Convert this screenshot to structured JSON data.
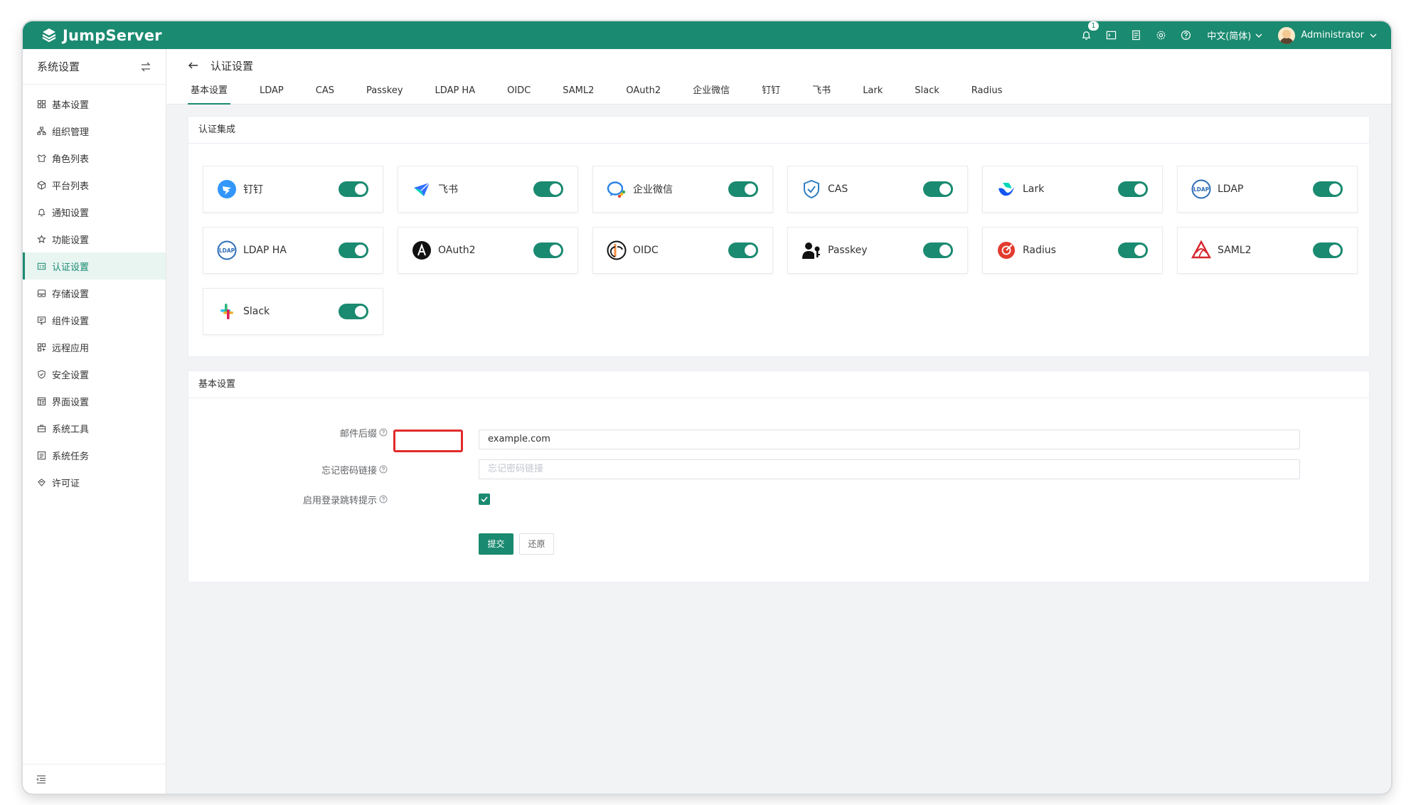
{
  "app": {
    "name": "JumpServer"
  },
  "topbar": {
    "notification_count": "1",
    "language": "中文(简体)",
    "user": "Administrator"
  },
  "sidebar": {
    "title": "系统设置",
    "items": [
      {
        "label": "基本设置",
        "icon": "grid-icon"
      },
      {
        "label": "组织管理",
        "icon": "org-icon"
      },
      {
        "label": "角色列表",
        "icon": "role-icon"
      },
      {
        "label": "平台列表",
        "icon": "cube-icon"
      },
      {
        "label": "通知设置",
        "icon": "bell-icon"
      },
      {
        "label": "功能设置",
        "icon": "star-icon"
      },
      {
        "label": "认证设置",
        "icon": "id-card-icon",
        "active": true
      },
      {
        "label": "存储设置",
        "icon": "storage-icon"
      },
      {
        "label": "组件设置",
        "icon": "monitor-icon"
      },
      {
        "label": "远程应用",
        "icon": "apps-icon"
      },
      {
        "label": "安全设置",
        "icon": "shield-icon"
      },
      {
        "label": "界面设置",
        "icon": "layout-icon"
      },
      {
        "label": "系统工具",
        "icon": "toolbox-icon"
      },
      {
        "label": "系统任务",
        "icon": "task-icon"
      },
      {
        "label": "许可证",
        "icon": "license-icon"
      }
    ]
  },
  "header": {
    "title": "认证设置",
    "tabs": [
      "基本设置",
      "LDAP",
      "CAS",
      "Passkey",
      "LDAP HA",
      "OIDC",
      "SAML2",
      "OAuth2",
      "企业微信",
      "钉钉",
      "飞书",
      "Lark",
      "Slack",
      "Radius"
    ],
    "active_tab": "基本设置"
  },
  "integration": {
    "title": "认证集成",
    "cards": [
      {
        "label": "钉钉",
        "icon": "dingtalk-icon",
        "enabled": true
      },
      {
        "label": "飞书",
        "icon": "feishu-icon",
        "enabled": true
      },
      {
        "label": "企业微信",
        "icon": "wecom-icon",
        "enabled": true
      },
      {
        "label": "CAS",
        "icon": "cas-shield-icon",
        "enabled": true
      },
      {
        "label": "Lark",
        "icon": "lark-icon",
        "enabled": true
      },
      {
        "label": "LDAP",
        "icon": "ldap-icon",
        "enabled": true
      },
      {
        "label": "LDAP HA",
        "icon": "ldap-ha-icon",
        "enabled": true
      },
      {
        "label": "OAuth2",
        "icon": "oauth2-icon",
        "enabled": true
      },
      {
        "label": "OIDC",
        "icon": "oidc-icon",
        "enabled": true
      },
      {
        "label": "Passkey",
        "icon": "passkey-icon",
        "enabled": true
      },
      {
        "label": "Radius",
        "icon": "radius-icon",
        "enabled": true
      },
      {
        "label": "SAML2",
        "icon": "saml2-icon",
        "enabled": true
      },
      {
        "label": "Slack",
        "icon": "slack-icon",
        "enabled": true
      }
    ]
  },
  "basic": {
    "title": "基本设置",
    "email_suffix_label": "邮件后缀",
    "email_suffix_value": "example.com",
    "forgot_link_label": "忘记密码链接",
    "forgot_link_placeholder": "忘记密码链接",
    "login_redirect_label": "启用登录跳转提示",
    "login_redirect_checked": true,
    "submit_label": "提交",
    "reset_label": "还原"
  },
  "colors": {
    "brand": "#1a8a70",
    "highlight": "#e02b2b"
  }
}
